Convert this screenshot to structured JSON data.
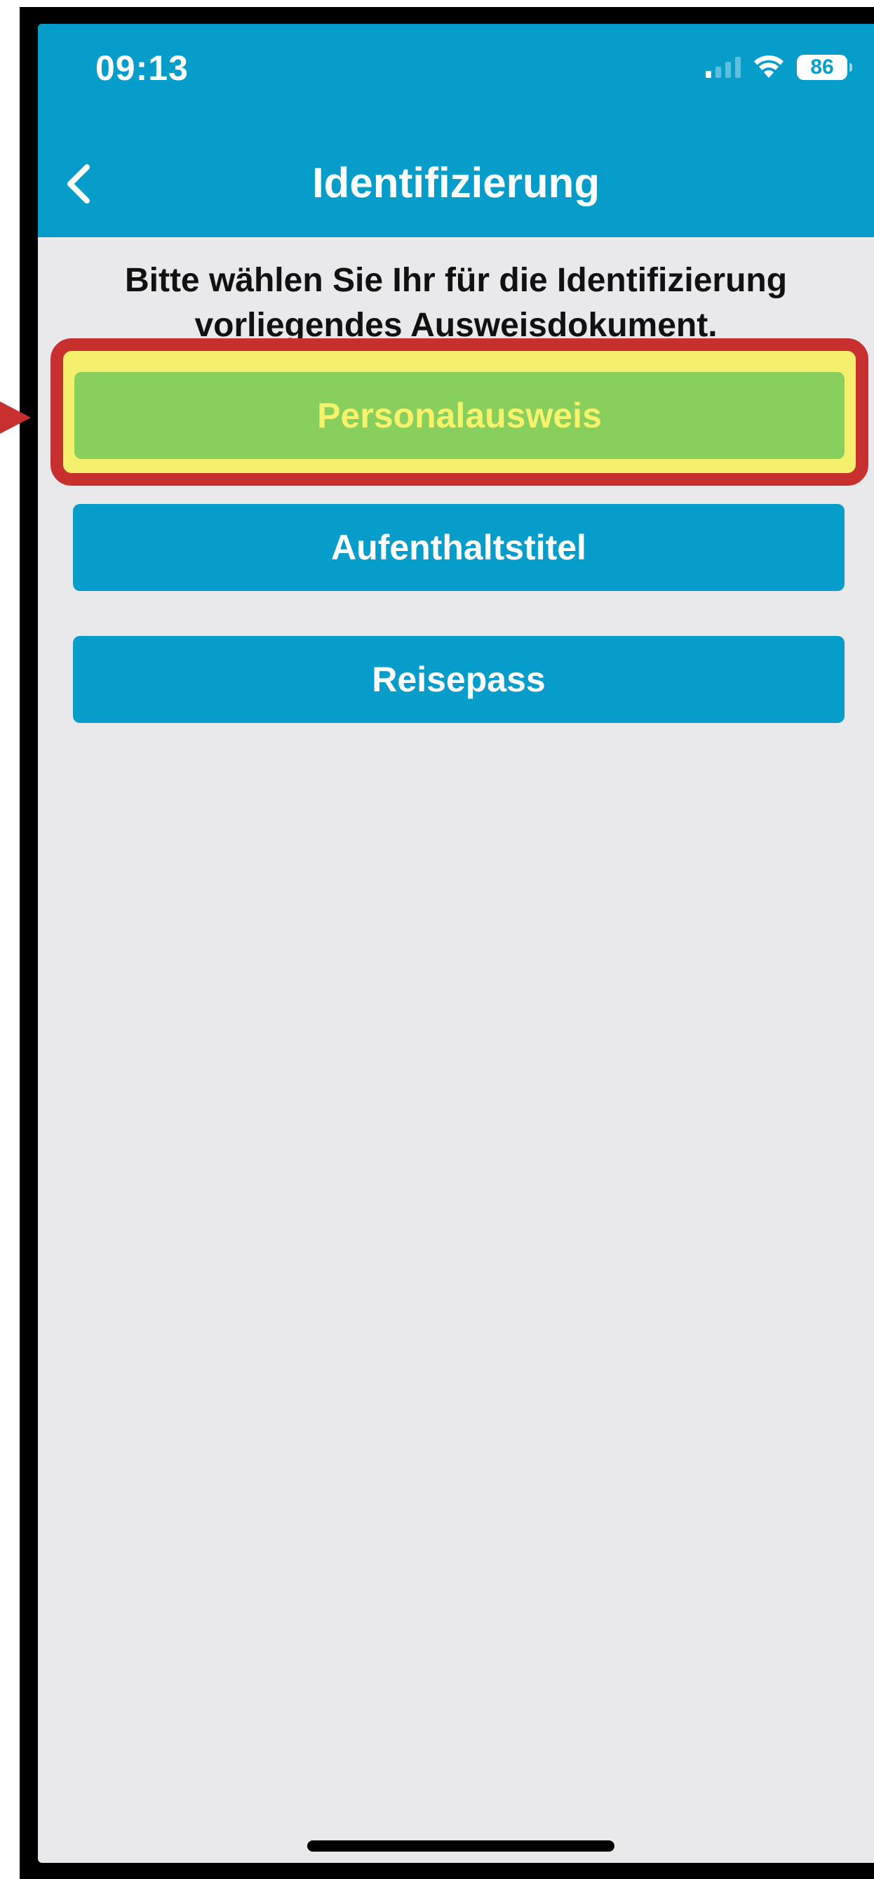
{
  "colors": {
    "header_bg": "#069dca",
    "button_bg": "#069dca",
    "selected_bg": "#88cf5e",
    "selected_text": "#f6f26a",
    "highlight_border": "#c8302f",
    "highlight_fill": "#f5ef6e"
  },
  "status_bar": {
    "time": "09:13",
    "battery": "86",
    "icons": [
      "signal-icon",
      "wifi-icon",
      "battery-icon"
    ]
  },
  "nav": {
    "back_icon": "chevron-left-icon",
    "title": "Identifizierung"
  },
  "content": {
    "prompt": "Bitte wählen Sie Ihr für die Identifizierung vorliegendes Ausweisdokument.",
    "documents": [
      {
        "label": "Personalausweis",
        "selected": true
      },
      {
        "label": "Aufenthaltstitel",
        "selected": false
      },
      {
        "label": "Reisepass",
        "selected": false
      }
    ]
  }
}
